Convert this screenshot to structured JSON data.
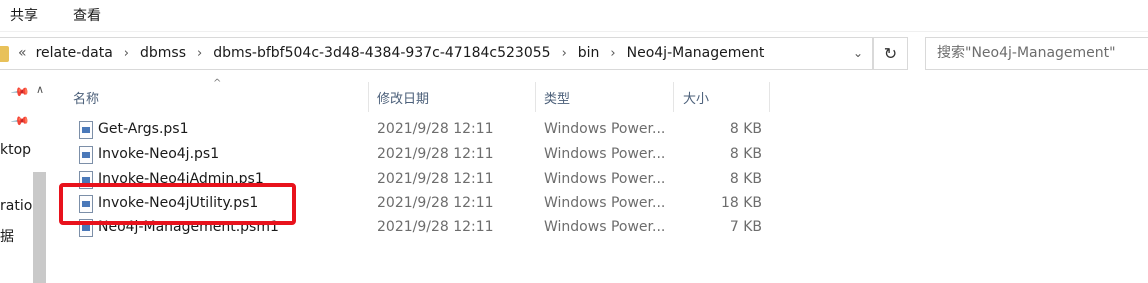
{
  "ribbon": {
    "tabs": [
      "共享",
      "查看"
    ]
  },
  "address": {
    "overflow": "«",
    "crumbs": [
      "relate-data",
      "dbmss",
      "dbms-bfbf504c-3d48-4384-937c-47184c523055",
      "bin",
      "Neo4j-Management"
    ],
    "dropdown": "⌄"
  },
  "refresh": "↻",
  "search": {
    "placeholder": "搜索\"Neo4j-Management\""
  },
  "nav": {
    "items": [
      "ktop",
      "ration",
      "据"
    ],
    "pin": "📌",
    "scroll_up": "∧"
  },
  "columns": {
    "name": "名称",
    "date": "修改日期",
    "type": "类型",
    "size": "大小",
    "sort": "^"
  },
  "files": [
    {
      "name": "Get-Args.ps1",
      "date": "2021/9/28 12:11",
      "type": "Windows Power...",
      "size": "8 KB"
    },
    {
      "name": "Invoke-Neo4j.ps1",
      "date": "2021/9/28 12:11",
      "type": "Windows Power...",
      "size": "8 KB"
    },
    {
      "name": "Invoke-Neo4jAdmin.ps1",
      "date": "2021/9/28 12:11",
      "type": "Windows Power...",
      "size": "8 KB"
    },
    {
      "name": "Invoke-Neo4jUtility.ps1",
      "date": "2021/9/28 12:11",
      "type": "Windows Power...",
      "size": "18 KB"
    },
    {
      "name": "Neo4j-Management.psm1",
      "date": "2021/9/28 12:11",
      "type": "Windows Power...",
      "size": "7 KB"
    }
  ],
  "colors": {
    "highlight": "#e8121c",
    "header_text": "#4c607a"
  }
}
